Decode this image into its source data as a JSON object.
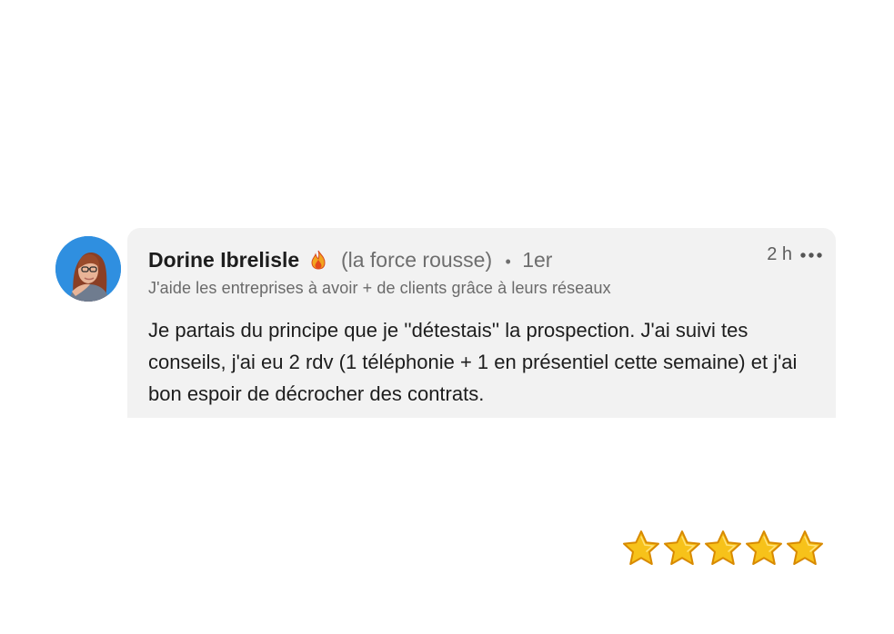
{
  "comment": {
    "author_name": "Dorine Ibrelisle",
    "name_emoji": "🔥",
    "pronouns": "(la force rousse)",
    "separator": "•",
    "degree": "1er",
    "time": "2 h",
    "headline": "J'aide les entreprises à avoir + de clients grâce à leurs réseaux",
    "text": "Je partais du principe que je ''détestais'' la prospection. J'ai suivi tes conseils, j'ai eu 2 rdv (1 téléphonie + 1 en présentiel cette semaine) et j'ai bon espoir de décrocher des contrats."
  },
  "rating": {
    "stars": 5,
    "max": 5
  },
  "icons": {
    "avatar": "avatar-photo",
    "flame": "fire-icon",
    "more": "more-icon",
    "star": "star-icon"
  },
  "colors": {
    "card_background": "#f2f2f2",
    "avatar_background": "#2f8fe0",
    "star_fill": "#f7c21a",
    "star_outline": "#d88a00"
  }
}
